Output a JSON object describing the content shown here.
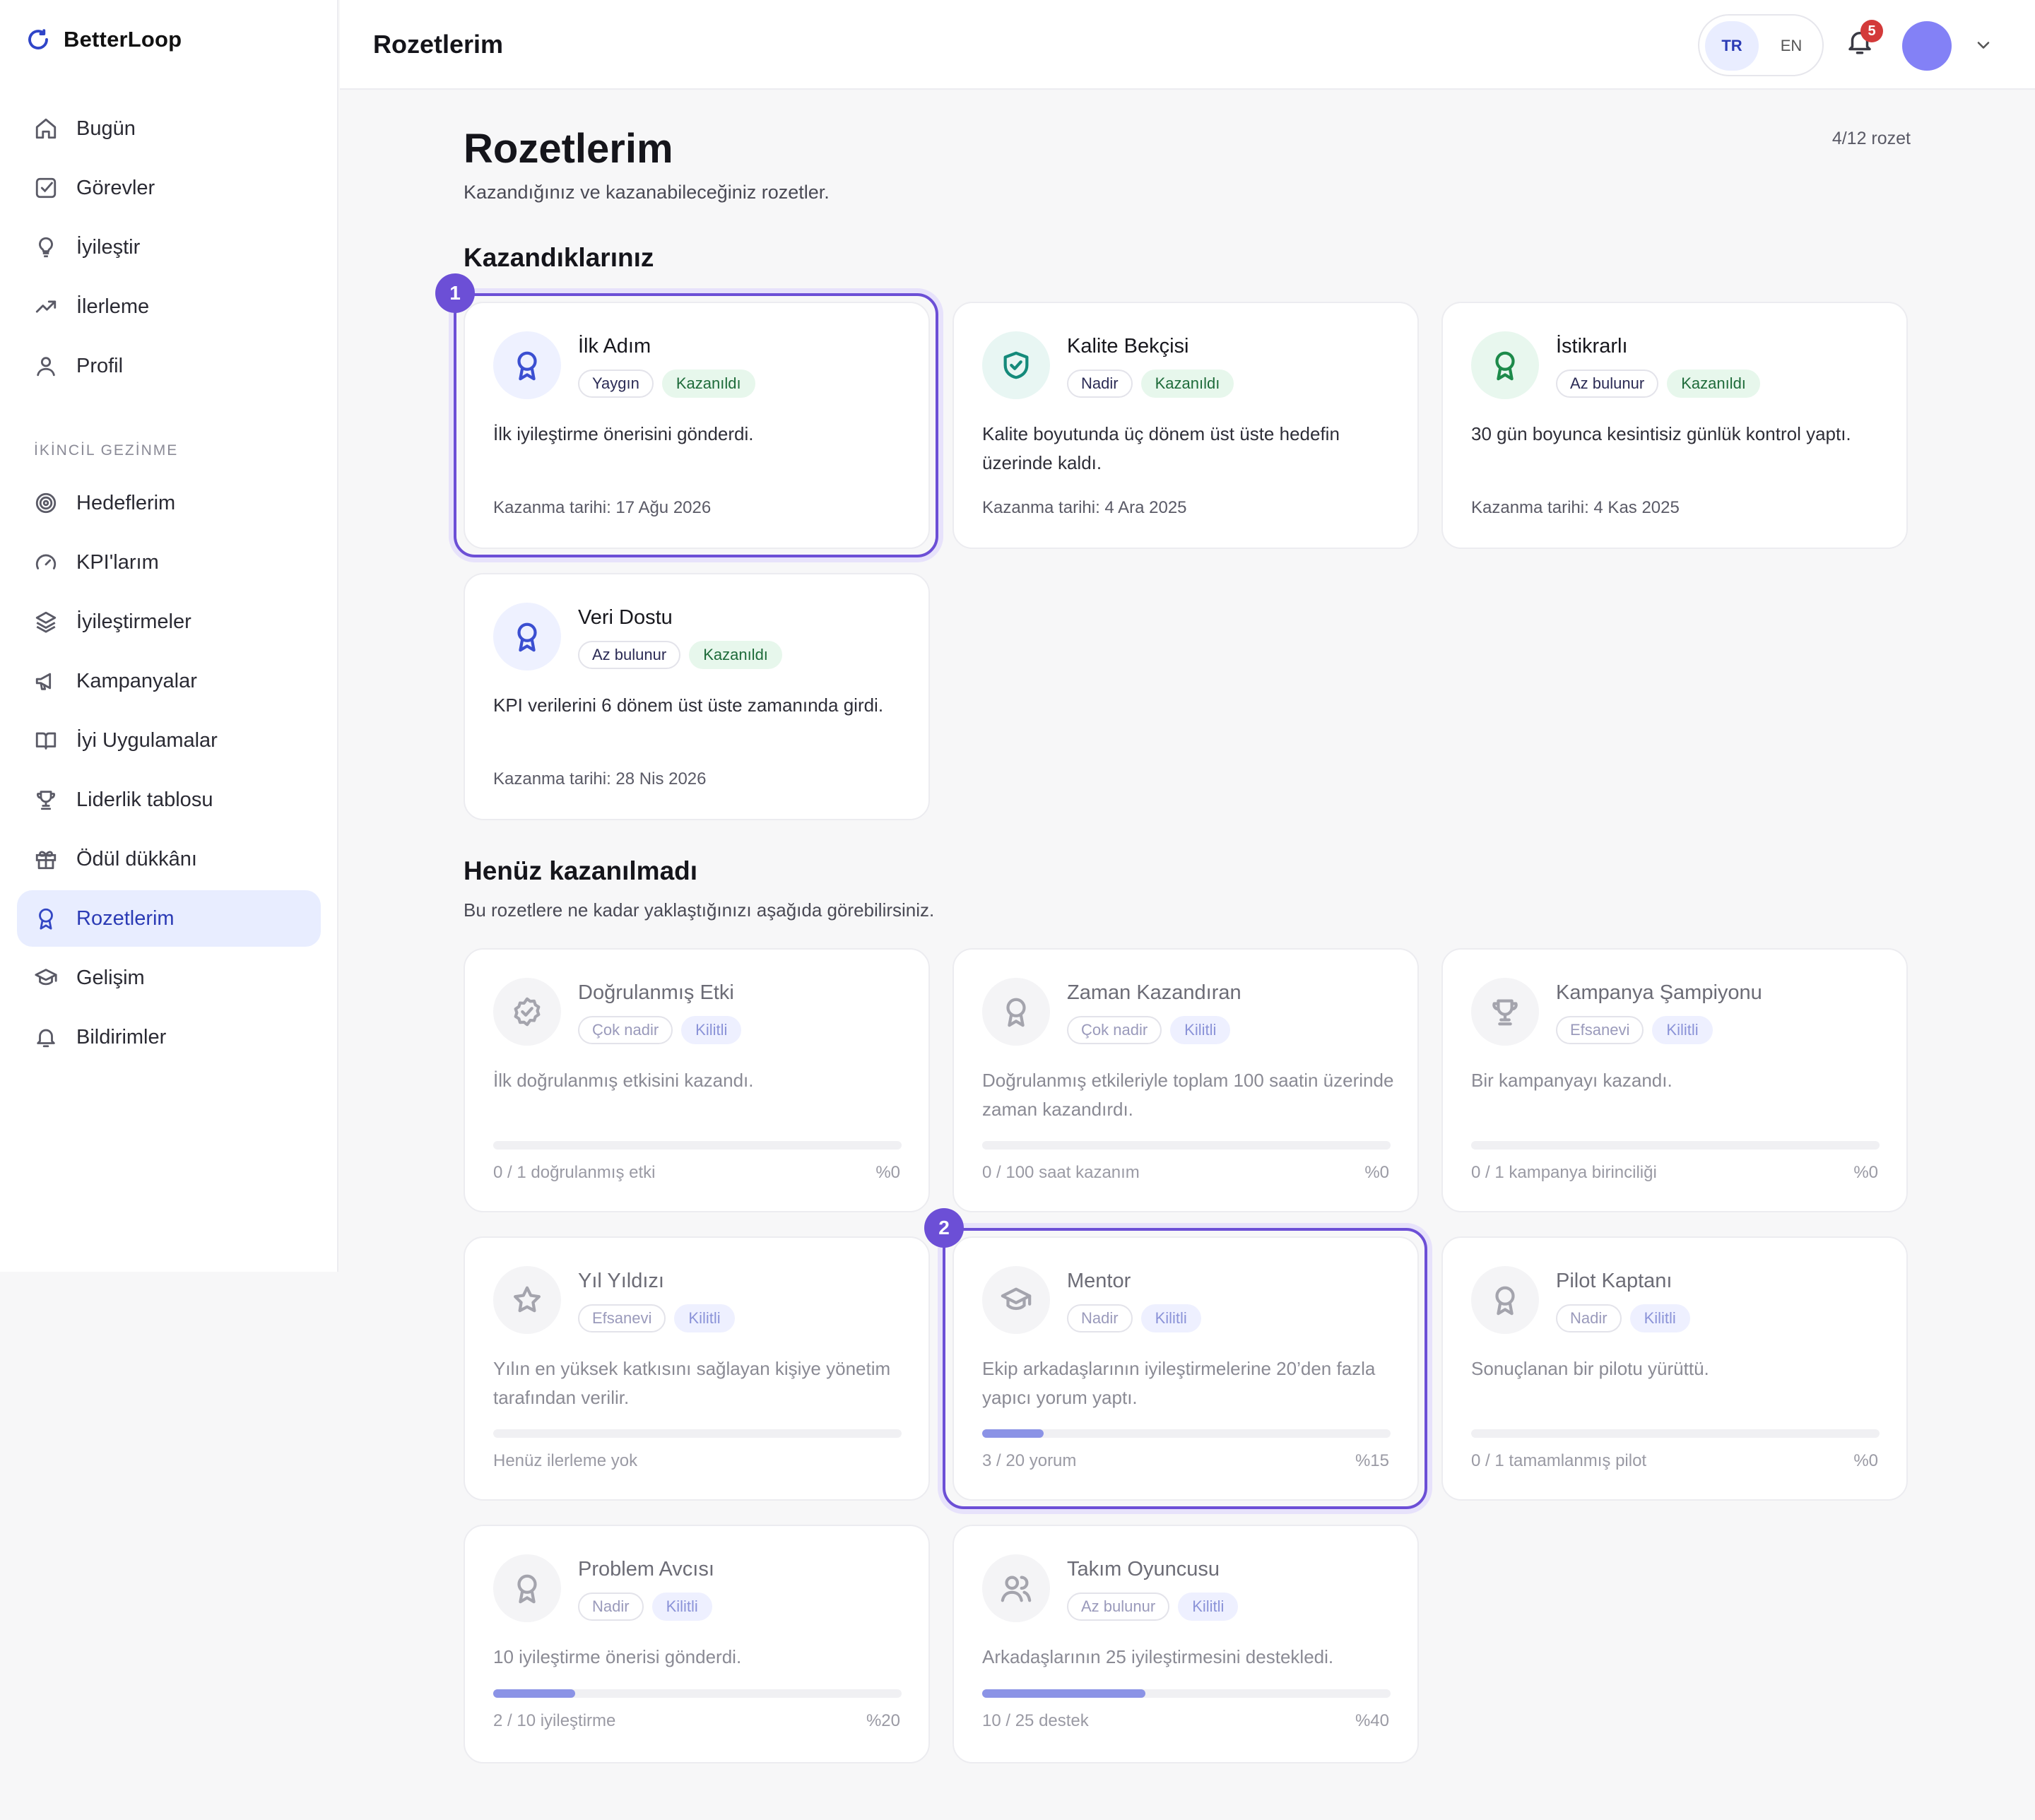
{
  "app": {
    "name": "BetterLoop"
  },
  "sidebar": {
    "primary": [
      {
        "label": "Bugün",
        "icon": "home-icon"
      },
      {
        "label": "Görevler",
        "icon": "checkbox-icon"
      },
      {
        "label": "İyileştir",
        "icon": "lightbulb-icon"
      },
      {
        "label": "İlerleme",
        "icon": "trending-up-icon"
      },
      {
        "label": "Profil",
        "icon": "user-icon"
      }
    ],
    "section_label": "İKİNCİL GEZİNME",
    "secondary": [
      {
        "label": "Hedeflerim",
        "icon": "target-icon"
      },
      {
        "label": "KPI'larım",
        "icon": "gauge-icon"
      },
      {
        "label": "İyileştirmeler",
        "icon": "layers-icon"
      },
      {
        "label": "Kampanyalar",
        "icon": "megaphone-icon"
      },
      {
        "label": "İyi Uygulamalar",
        "icon": "book-icon"
      },
      {
        "label": "Liderlik tablosu",
        "icon": "trophy-icon"
      },
      {
        "label": "Ödül dükkânı",
        "icon": "gift-icon"
      },
      {
        "label": "Rozetlerim",
        "icon": "award-icon",
        "active": true
      },
      {
        "label": "Gelişim",
        "icon": "graduation-cap-icon"
      },
      {
        "label": "Bildirimler",
        "icon": "bell-icon"
      }
    ]
  },
  "topbar": {
    "title": "Rozetlerim",
    "lang": {
      "tr": "TR",
      "en": "EN",
      "selected": "TR"
    },
    "notifications_count": "5"
  },
  "page": {
    "title": "Rozetlerim",
    "subtitle": "Kazandığınız ve kazanabileceğiniz rozetler.",
    "count": "4/12 rozet",
    "earned_heading": "Kazandıklarınız",
    "locked_heading": "Henüz kazanılmadı",
    "locked_subtitle": "Bu rozetlere ne kadar yaklaştığınızı aşağıda görebilirsiniz."
  },
  "earned": [
    {
      "title": "İlk Adım",
      "rarity": "Yaygın",
      "status": "Kazanıldı",
      "desc": "İlk iyileştirme önerisini gönderdi.",
      "date": "Kazanma tarihi: 17 Ağu 2026",
      "icon": "award-icon",
      "color": "#3b4fd1",
      "bg": "#eef1ff"
    },
    {
      "title": "Kalite Bekçisi",
      "rarity": "Nadir",
      "status": "Kazanıldı",
      "desc": "Kalite boyutunda üç dönem üst üste hedefin üzerinde kaldı.",
      "date": "Kazanma tarihi: 4 Ara 2025",
      "icon": "shield-check-icon",
      "color": "#148a7a",
      "bg": "#e8f6f3"
    },
    {
      "title": "İstikrarlı",
      "rarity": "Az bulunur",
      "status": "Kazanıldı",
      "desc": "30 gün boyunca kesintisiz günlük kontrol yaptı.",
      "date": "Kazanma tarihi: 4 Kas 2025",
      "icon": "award-icon",
      "color": "#1d8a4a",
      "bg": "#e8f7ee"
    },
    {
      "title": "Veri Dostu",
      "rarity": "Az bulunur",
      "status": "Kazanıldı",
      "desc": "KPI verilerini 6 dönem üst üste zamanında girdi.",
      "date": "Kazanma tarihi: 28 Nis 2026",
      "icon": "award-icon",
      "color": "#3b4fd1",
      "bg": "#eef1ff"
    }
  ],
  "locked": [
    {
      "title": "Doğrulanmış Etki",
      "rarity": "Çok nadir",
      "status": "Kilitli",
      "desc": "İlk doğrulanmış etkisini kazandı.",
      "progress_label": "0 / 1 doğrulanmış etki",
      "pct": "%0",
      "progress": 0,
      "icon": "badge-check-icon"
    },
    {
      "title": "Zaman Kazandıran",
      "rarity": "Çok nadir",
      "status": "Kilitli",
      "desc": "Doğrulanmış etkileriyle toplam 100 saatin üzerinde zaman kazandırdı.",
      "progress_label": "0 / 100 saat kazanım",
      "pct": "%0",
      "progress": 0,
      "icon": "award-icon"
    },
    {
      "title": "Kampanya Şampiyonu",
      "rarity": "Efsanevi",
      "status": "Kilitli",
      "desc": "Bir kampanyayı kazandı.",
      "progress_label": "0 / 1 kampanya birinciliği",
      "pct": "%0",
      "progress": 0,
      "icon": "trophy-icon"
    },
    {
      "title": "Yıl Yıldızı",
      "rarity": "Efsanevi",
      "status": "Kilitli",
      "desc": "Yılın en yüksek katkısını sağlayan kişiye yönetim tarafından verilir.",
      "progress_label": "Henüz ilerleme yok",
      "pct": "",
      "progress": 0,
      "icon": "star-icon"
    },
    {
      "title": "Mentor",
      "rarity": "Nadir",
      "status": "Kilitli",
      "desc": "Ekip arkadaşlarının iyileştirmelerine 20’den fazla yapıcı yorum yaptı.",
      "progress_label": "3 / 20 yorum",
      "pct": "%15",
      "progress": 0.15,
      "icon": "graduation-cap-icon"
    },
    {
      "title": "Pilot Kaptanı",
      "rarity": "Nadir",
      "status": "Kilitli",
      "desc": "Sonuçlanan bir pilotu yürüttü.",
      "progress_label": "0 / 1 tamamlanmış pilot",
      "pct": "%0",
      "progress": 0,
      "icon": "award-icon"
    },
    {
      "title": "Problem Avcısı",
      "rarity": "Nadir",
      "status": "Kilitli",
      "desc": "10 iyileştirme önerisi gönderdi.",
      "progress_label": "2 / 10 iyileştirme",
      "pct": "%20",
      "progress": 0.2,
      "icon": "award-icon"
    },
    {
      "title": "Takım Oyuncusu",
      "rarity": "Az bulunur",
      "status": "Kilitli",
      "desc": "Arkadaşlarının 25 iyileştirmesini destekledi.",
      "progress_label": "10 / 25 destek",
      "pct": "%40",
      "progress": 0.4,
      "icon": "users-icon"
    }
  ],
  "markers": [
    "1",
    "2"
  ]
}
